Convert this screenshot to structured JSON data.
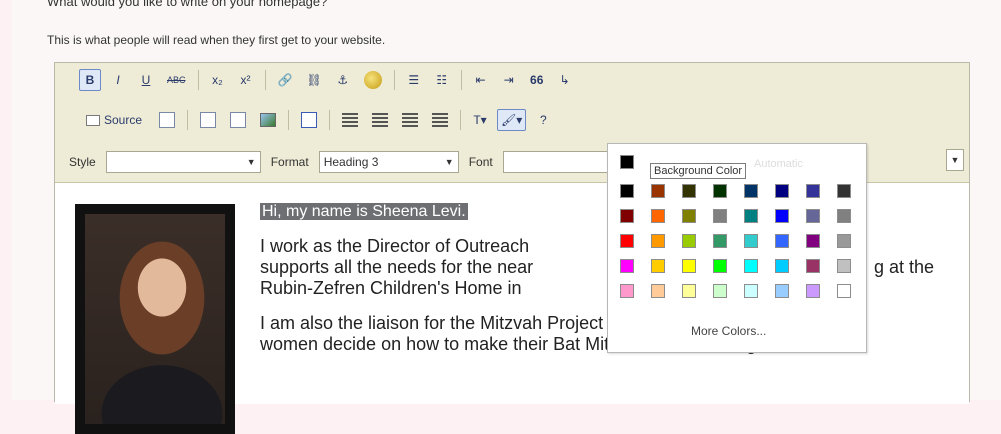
{
  "page": {
    "question": "What would you like to write on your homepage?",
    "helper": "This is what people will read when they first get to your website."
  },
  "toolbar": {
    "row1": [
      "B",
      "I",
      "U",
      "ABC",
      "x₂",
      "x²",
      "link",
      "unlink",
      "anchor",
      "smiley",
      "ol",
      "ul",
      "outdent",
      "indent",
      "quote",
      "special"
    ],
    "source_label": "Source",
    "style_label": "Style",
    "format_label": "Format",
    "format_value": "Heading 3",
    "font_label": "Font"
  },
  "content": {
    "heading": "Hi, my name is Sheena Levi.",
    "para1_line1": "I work as the Director of Outreach",
    "para1_line1_tail": "",
    "para1_line2": "supports all the needs for the near",
    "para1_line2_tail": "g at the",
    "para1_line3": "Rubin-Zefren Children's  Home in",
    "para2_line1": "I am also the liaison for the Mitzvah Project Program and help young",
    "para2_line2": "women decide on how to make their Bat Mitzvah fun, meaningful"
  },
  "color_popup": {
    "tooltip": "Background Color",
    "auto_label": "Automatic",
    "more_colors": "More Colors...",
    "swatches": [
      "#000000",
      "#993300",
      "#333300",
      "#003300",
      "#003366",
      "#000080",
      "#333399",
      "#333333",
      "#800000",
      "#ff6600",
      "#808000",
      "#808080",
      "#008080",
      "#0000ff",
      "#666699",
      "#808080",
      "#ff0000",
      "#ff9900",
      "#99cc00",
      "#339966",
      "#33cccc",
      "#3366ff",
      "#800080",
      "#999999",
      "#ff00ff",
      "#ffcc00",
      "#ffff00",
      "#00ff00",
      "#00ffff",
      "#00ccff",
      "#993366",
      "#c0c0c0",
      "#ff99cc",
      "#ffcc99",
      "#ffff99",
      "#ccffcc",
      "#ccffff",
      "#99ccff",
      "#cc99ff",
      "#ffffff"
    ]
  }
}
